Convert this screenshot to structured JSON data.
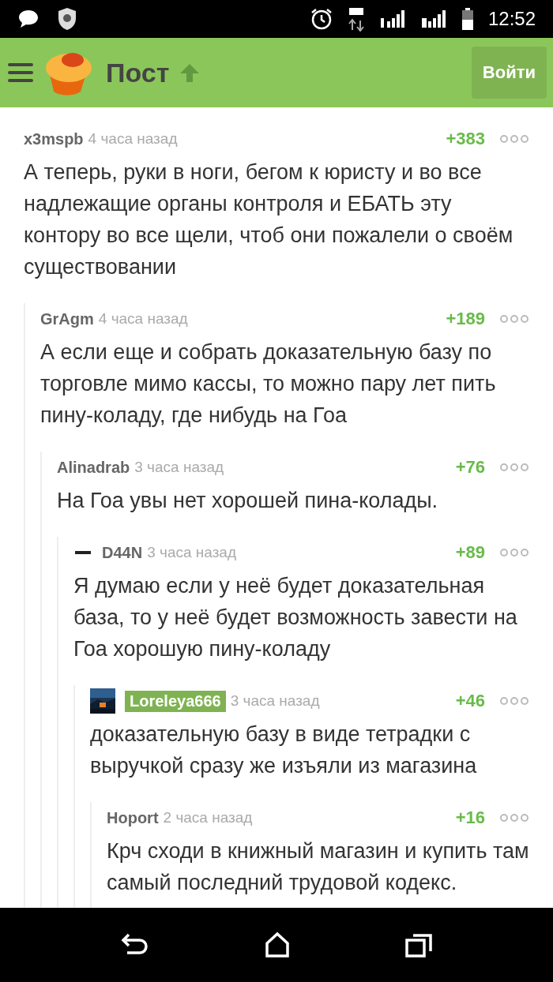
{
  "status_bar": {
    "time": "12:52"
  },
  "header": {
    "title": "Пост",
    "login_button": "Войти"
  },
  "comments": [
    {
      "author": "x3mspb",
      "highlighted": false,
      "time": "4 часа назад",
      "rating": "+383",
      "text": "А теперь, руки в ноги, бегом к юристу и во все надлежащие органы контроля и ЕБАТЬ эту контору во все щели, чтоб они пожалели о своём существовании",
      "children": [
        {
          "author": "GrAgm",
          "highlighted": false,
          "time": "4 часа назад",
          "rating": "+189",
          "text": "А если еще и собрать доказательную базу по торговле мимо кассы, то можно пару лет пить пину-коладу, где нибудь на Гоа",
          "children": [
            {
              "author": "Alinadrab",
              "highlighted": false,
              "time": "3 часа назад",
              "rating": "+76",
              "text": "На Гоа увы нет хорошей пина-колады.",
              "children": [
                {
                  "avatar": {
                    "kind": "logo"
                  },
                  "author": "D44N",
                  "highlighted": false,
                  "time": "3 часа назад",
                  "rating": "+89",
                  "text": "Я думаю если у неё будет доказательная база, то у неё будет возможность завести на Гоа хорошую пину-коладу",
                  "children": [
                    {
                      "author": "Loreleya666",
                      "highlighted": true,
                      "time": "3 часа назад",
                      "rating": "+46",
                      "text": "доказательную базу в виде тетрадки с выручкой сразу же изъяли из магазина",
                      "children": [
                        {
                          "author": "Hoport",
                          "highlighted": false,
                          "time": "2 часа назад",
                          "rating": "+16",
                          "text": "Крч сходи в книжный магазин и купить там самый последний трудовой кодекс."
                        }
                      ]
                    }
                  ]
                }
              ]
            }
          ]
        }
      ]
    }
  ]
}
